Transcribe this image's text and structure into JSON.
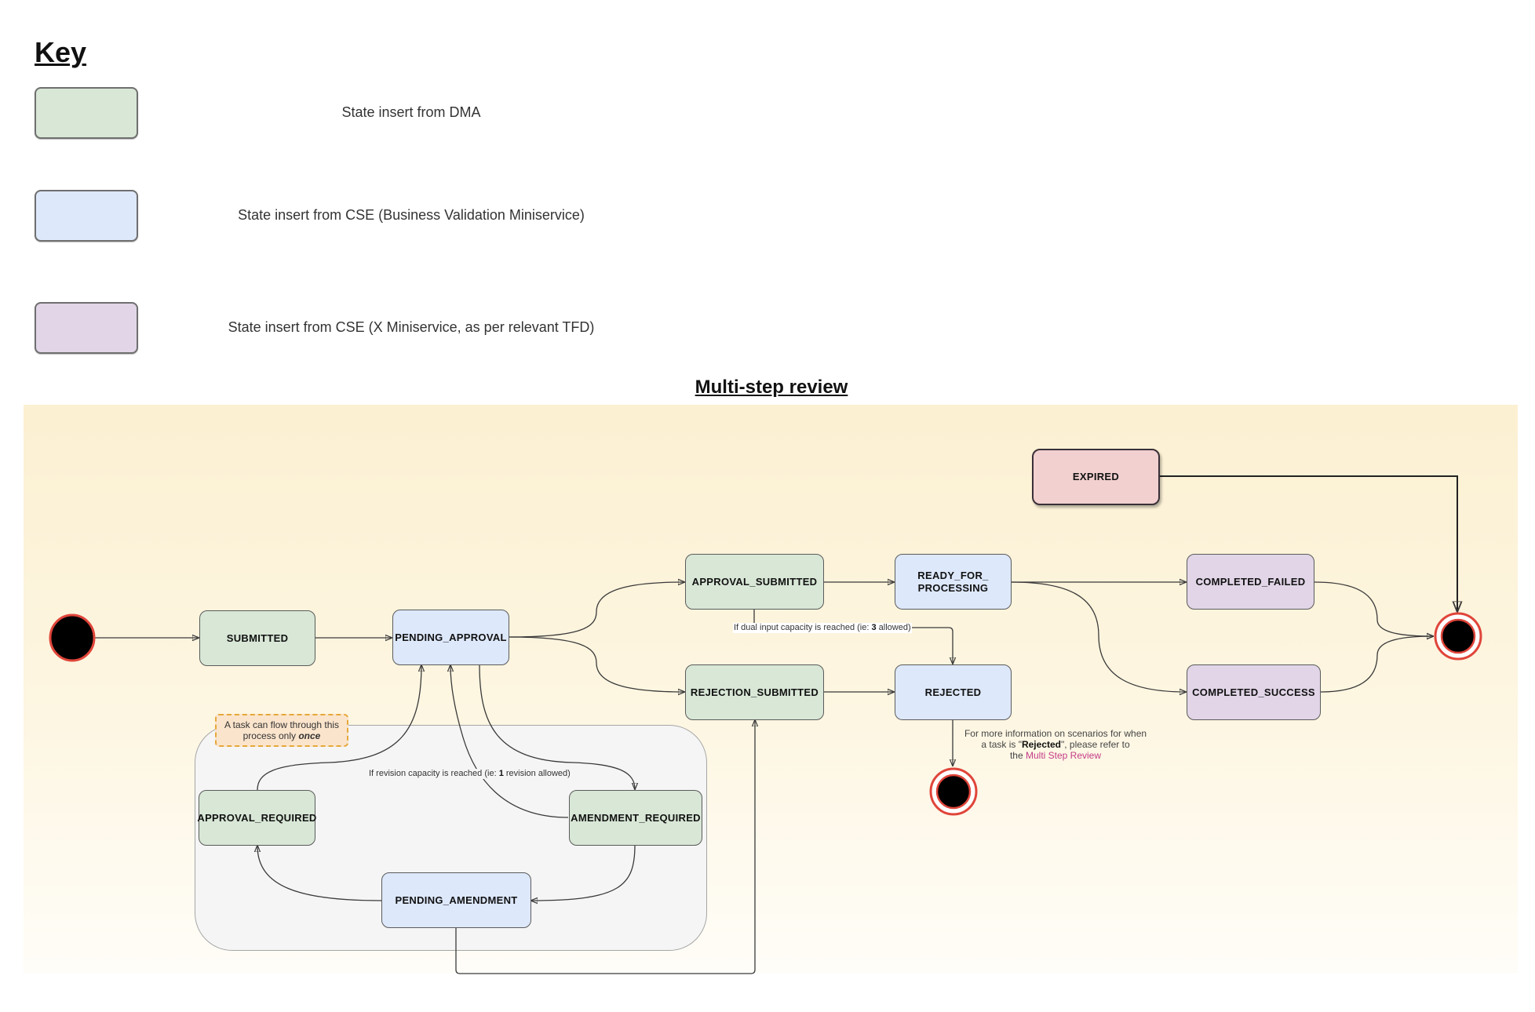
{
  "key": {
    "title": "Key",
    "items": [
      {
        "label": "State insert from DMA",
        "color": "#d8e7d6"
      },
      {
        "label": "State insert from CSE (Business Validation Miniservice)",
        "color": "#dde8fb"
      },
      {
        "label": "State insert from CSE (X Miniservice, as per relevant TFD)",
        "color": "#e1d5e7"
      }
    ]
  },
  "diagram": {
    "title": "Multi-step review",
    "states": {
      "submitted": "SUBMITTED",
      "pending_approval": "PENDING_APPROVAL",
      "approval_submitted": "APPROVAL_SUBMITTED",
      "rejection_submitted": "REJECTION_SUBMITTED",
      "ready_for_processing": "READY_FOR_ PROCESSING",
      "rejected": "REJECTED",
      "completed_failed": "COMPLETED_FAILED",
      "completed_success": "COMPLETED_SUCCESS",
      "expired": "EXPIRED",
      "approval_required": "APPROVAL_REQUIRED",
      "amendment_required": "AMENDMENT_REQUIRED",
      "pending_amendment": "PENDING_AMENDMENT"
    },
    "note": {
      "text": "A task can flow through this process only",
      "emphasis": "once"
    },
    "labels": {
      "dual_input_prefix": "If dual input capacity is reached (ie: ",
      "dual_input_number": "3",
      "dual_input_suffix": " allowed)",
      "revision_prefix": "If revision capacity is reached (ie: ",
      "revision_number": "1",
      "revision_suffix": " revision allowed)"
    },
    "rejected_info": {
      "line1": "For more information on scenarios for when",
      "line2_prefix": "a task is \"",
      "line2_bold": "Rejected",
      "line2_suffix": "\", please refer to",
      "line3_prefix": "the ",
      "link_text": "Multi Step Review"
    },
    "colors": {
      "dma": "#d8e7d6",
      "cse_business_validation": "#dde8fb",
      "cse_x_miniservice": "#e1d5e7",
      "expired": "#f2d0d0",
      "terminal_ring": "#e0453a",
      "link": "#c43b86"
    }
  }
}
